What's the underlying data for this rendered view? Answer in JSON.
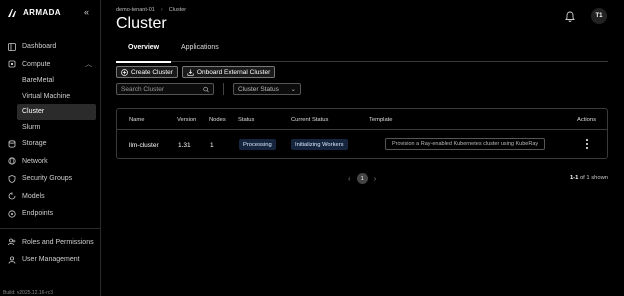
{
  "brand": {
    "name": "ARMADA"
  },
  "sidebar": {
    "items": [
      {
        "label": "Dashboard",
        "icon": "dashboard-icon"
      },
      {
        "label": "Compute",
        "icon": "compute-icon"
      },
      {
        "label": "Storage",
        "icon": "storage-icon"
      },
      {
        "label": "Network",
        "icon": "network-icon"
      },
      {
        "label": "Security Groups",
        "icon": "shield-icon"
      },
      {
        "label": "Models",
        "icon": "models-icon"
      },
      {
        "label": "Endpoints",
        "icon": "endpoints-icon"
      },
      {
        "label": "Roles and Permissions",
        "icon": "users-icon"
      },
      {
        "label": "User Management",
        "icon": "user-icon"
      }
    ],
    "compute_sub": [
      "BareMetal",
      "Virtual Machine",
      "Cluster",
      "Slurm"
    ],
    "build": "Build: v2025.12.16-rc3"
  },
  "header": {
    "breadcrumb": [
      "demo-tenant-01",
      "Cluster"
    ],
    "title": "Cluster",
    "avatar_initials": "T1"
  },
  "tabs": [
    "Overview",
    "Applications"
  ],
  "toolbar": {
    "create_label": "Create Cluster",
    "onboard_label": "Onboard External Cluster"
  },
  "filters": {
    "search_placeholder": "Search Cluster",
    "status_label": "Cluster Status"
  },
  "table": {
    "headers": [
      "Name",
      "Version",
      "Nodes",
      "Status",
      "Current Status",
      "Template",
      "Actions"
    ],
    "rows": [
      {
        "name": "llm-cluster",
        "version": "1.31",
        "nodes": "1",
        "status": "Processing",
        "current_status": "Initializing Workers",
        "template": "Provision a Ray-enabled Kubernetes cluster using KubeRay"
      }
    ]
  },
  "pagination": {
    "page": "1",
    "range": "1-1",
    "of_text": "of 1 shown"
  }
}
